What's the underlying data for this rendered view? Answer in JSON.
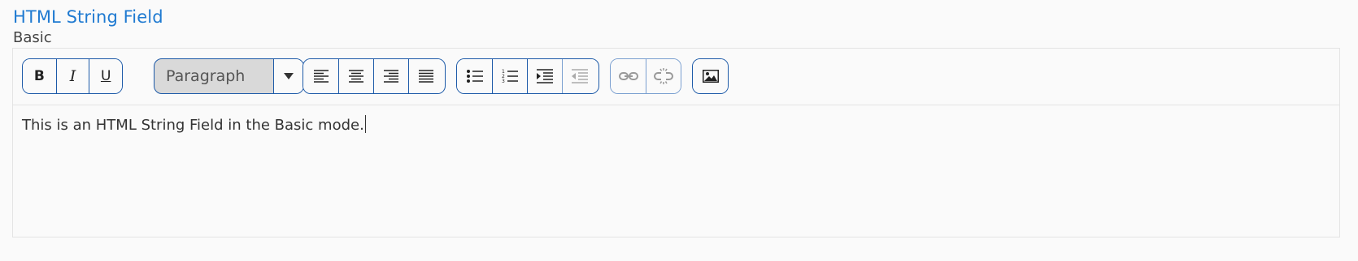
{
  "field": {
    "title": "HTML String Field",
    "subtitle": "Basic"
  },
  "toolbar": {
    "bold_label": "B",
    "italic_label": "I",
    "underline_label": "U",
    "format_value": "Paragraph",
    "buttons": [
      {
        "name": "bold-button",
        "icon": "bold"
      },
      {
        "name": "italic-button",
        "icon": "italic"
      },
      {
        "name": "underline-button",
        "icon": "underline"
      },
      {
        "name": "align-left-button",
        "icon": "align-left-icon"
      },
      {
        "name": "align-center-button",
        "icon": "align-center-icon"
      },
      {
        "name": "align-right-button",
        "icon": "align-right-icon"
      },
      {
        "name": "align-justify-button",
        "icon": "align-justify-icon"
      },
      {
        "name": "bullet-list-button",
        "icon": "bullet-list-icon"
      },
      {
        "name": "numbered-list-button",
        "icon": "numbered-list-icon"
      },
      {
        "name": "indent-button",
        "icon": "indent-icon"
      },
      {
        "name": "outdent-button",
        "icon": "outdent-icon",
        "disabled": true
      },
      {
        "name": "link-button",
        "icon": "link-icon",
        "disabled": true
      },
      {
        "name": "unlink-button",
        "icon": "unlink-icon",
        "disabled": true
      },
      {
        "name": "image-button",
        "icon": "image-icon"
      }
    ]
  },
  "editor": {
    "content": "This is an HTML String Field in the Basic mode."
  },
  "colors": {
    "title": "#1f7ad1",
    "button_border": "#1d5aa8",
    "select_bg": "#d9d9d9",
    "background": "#fafafa"
  }
}
